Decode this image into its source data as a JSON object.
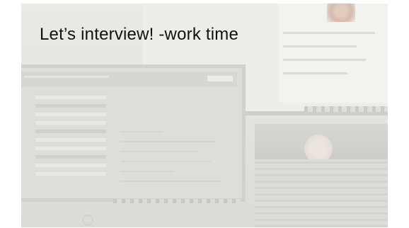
{
  "slide": {
    "title": "Let’s interview! -work time"
  },
  "background_image": {
    "icon": "office-desk-photo-icon",
    "colors": {
      "wash": "#d9d9d4",
      "title_text": "#111111"
    }
  }
}
